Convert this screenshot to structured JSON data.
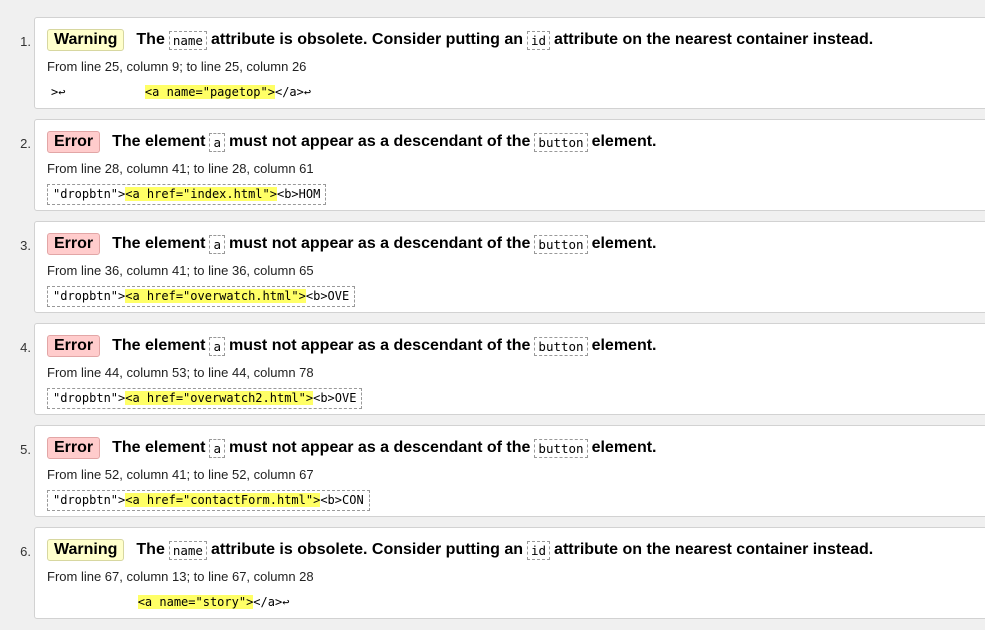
{
  "messages": [
    {
      "number": "1.",
      "type": "warning",
      "badge": "Warning",
      "parts": [
        "The",
        "name",
        "attribute is obsolete. Consider putting an",
        "id",
        "attribute on the nearest container instead."
      ],
      "location": "From line 25, column 9; to line 25, column 26",
      "extract_before": ">↩           ",
      "extract_highlight": "<a name=\"pagetop\">",
      "extract_after": "</a>↩",
      "boxed": false
    },
    {
      "number": "2.",
      "type": "error",
      "badge": "Error",
      "parts": [
        "The element",
        "a",
        "must not appear as a descendant of the",
        "button",
        "element."
      ],
      "location": "From line 28, column 41; to line 28, column 61",
      "extract_before": "\"dropbtn\">",
      "extract_highlight": "<a href=\"index.html\">",
      "extract_after": "<b>HOM",
      "boxed": true
    },
    {
      "number": "3.",
      "type": "error",
      "badge": "Error",
      "parts": [
        "The element",
        "a",
        "must not appear as a descendant of the",
        "button",
        "element."
      ],
      "location": "From line 36, column 41; to line 36, column 65",
      "extract_before": "\"dropbtn\">",
      "extract_highlight": "<a href=\"overwatch.html\">",
      "extract_after": "<b>OVE",
      "boxed": true
    },
    {
      "number": "4.",
      "type": "error",
      "badge": "Error",
      "parts": [
        "The element",
        "a",
        "must not appear as a descendant of the",
        "button",
        "element."
      ],
      "location": "From line 44, column 53; to line 44, column 78",
      "extract_before": "\"dropbtn\">",
      "extract_highlight": "<a href=\"overwatch2.html\">",
      "extract_after": "<b>OVE",
      "boxed": true
    },
    {
      "number": "5.",
      "type": "error",
      "badge": "Error",
      "parts": [
        "The element",
        "a",
        "must not appear as a descendant of the",
        "button",
        "element."
      ],
      "location": "From line 52, column 41; to line 52, column 67",
      "extract_before": "\"dropbtn\">",
      "extract_highlight": "<a href=\"contactForm.html\">",
      "extract_after": "<b>CON",
      "boxed": true
    },
    {
      "number": "6.",
      "type": "warning",
      "badge": "Warning",
      "parts": [
        "The",
        "name",
        "attribute is obsolete. Consider putting an",
        "id",
        "attribute on the nearest container instead."
      ],
      "location": "From line 67, column 13; to line 67, column 28",
      "extract_before": "            ",
      "extract_highlight": "<a name=\"story\">",
      "extract_after": "</a>↩",
      "boxed": false
    }
  ]
}
